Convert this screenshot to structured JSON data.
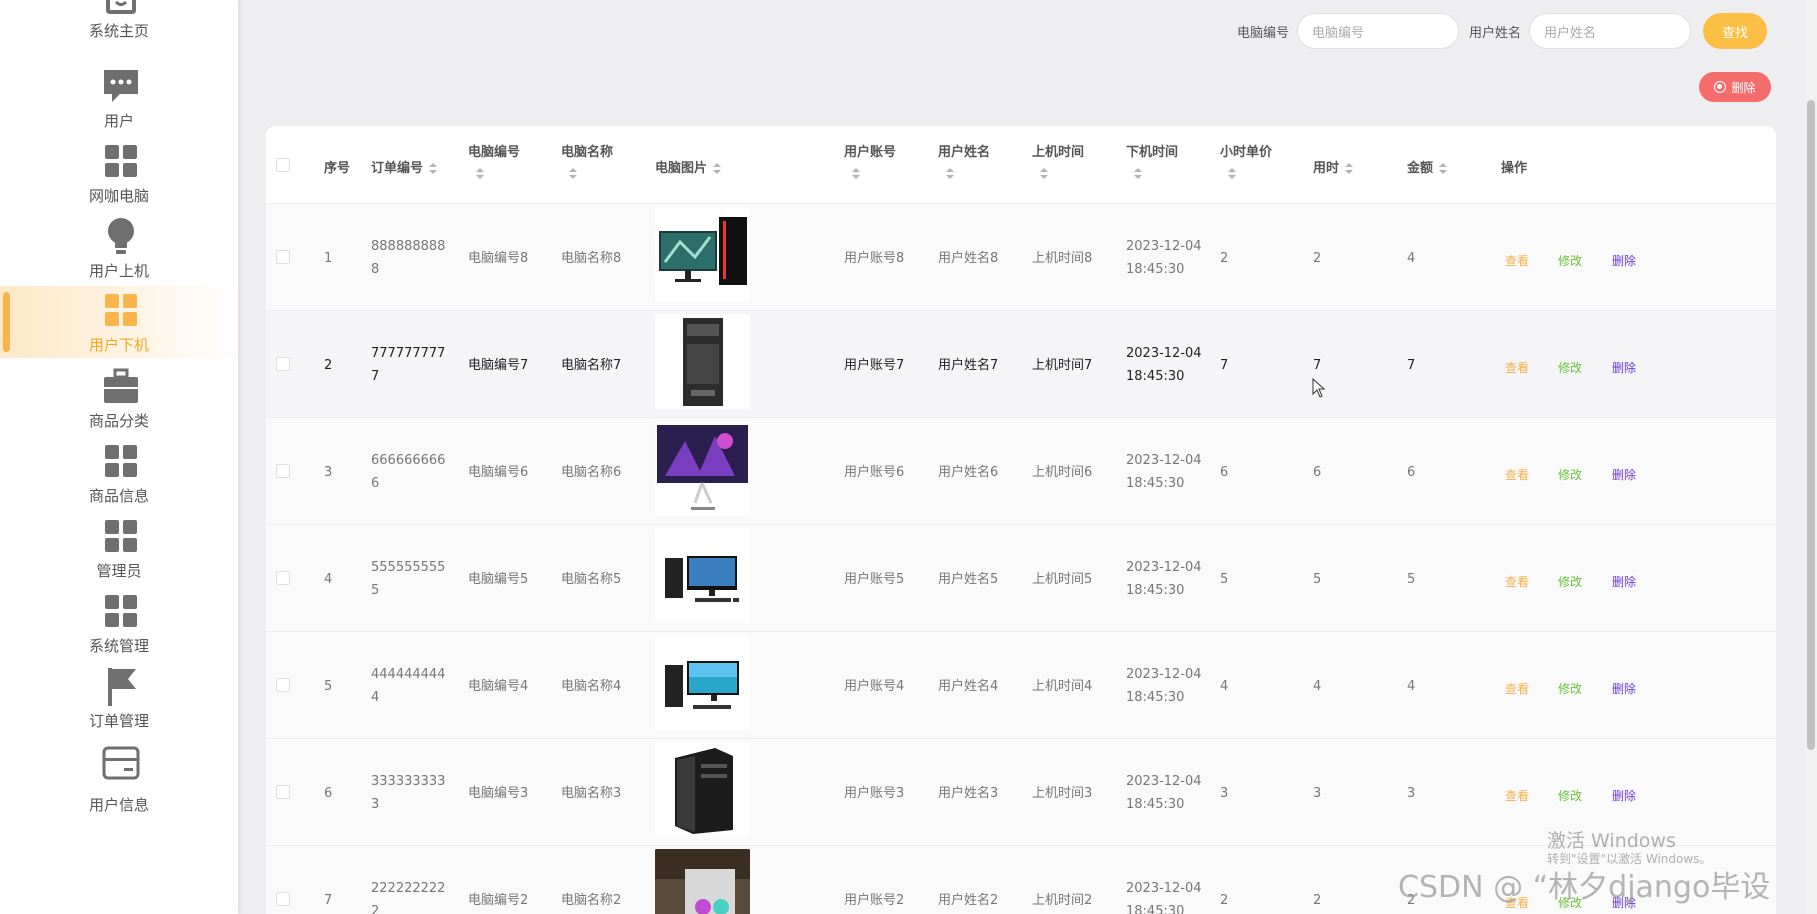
{
  "sidebar": {
    "items": [
      {
        "label": "系统主页",
        "icon": "home-box-icon"
      },
      {
        "label": "用户",
        "icon": "chat-icon"
      },
      {
        "label": "网咖电脑",
        "icon": "grid-icon"
      },
      {
        "label": "用户上机",
        "icon": "bulb-icon"
      },
      {
        "label": "用户下机",
        "icon": "grid-icon",
        "active": true
      },
      {
        "label": "商品分类",
        "icon": "briefcase-icon"
      },
      {
        "label": "商品信息",
        "icon": "grid-icon"
      },
      {
        "label": "管理员",
        "icon": "grid-icon"
      },
      {
        "label": "系统管理",
        "icon": "grid-icon"
      },
      {
        "label": "订单管理",
        "icon": "flag-icon"
      },
      {
        "label": "用户信息",
        "icon": "card-icon"
      }
    ]
  },
  "search": {
    "pc_number_label": "电脑编号",
    "pc_number_placeholder": "电脑编号",
    "user_name_label": "用户姓名",
    "user_name_placeholder": "用户姓名",
    "search_button": "查找",
    "delete_button": "删除"
  },
  "table": {
    "headers": {
      "index": "序号",
      "order_no": "订单编号",
      "pc_no": "电脑编号",
      "pc_name": "电脑名称",
      "pc_image": "电脑图片",
      "account": "用户账号",
      "user_name": "用户姓名",
      "start_time": "上机时间",
      "end_time": "下机时间",
      "hourly_price": "小时单价",
      "hours": "用时",
      "amount": "金额",
      "actions": "操作"
    },
    "action_labels": {
      "view": "查看",
      "edit": "修改",
      "delete": "删除"
    },
    "rows": [
      {
        "index": "1",
        "order_line1": "888888888",
        "order_line2": "8",
        "pc_no": "电脑编号8",
        "pc_name": "电脑名称8",
        "image": "gaming-pc-monitor",
        "account": "用户账号8",
        "user_name": "用户姓名8",
        "start_time": "上机时间8",
        "end_date": "2023-12-04",
        "end_clock": "18:45:30",
        "hourly_price": "2",
        "hours": "2",
        "amount": "4"
      },
      {
        "index": "2",
        "order_line1": "777777777",
        "order_line2": "7",
        "pc_no": "电脑编号7",
        "pc_name": "电脑名称7",
        "image": "tower-pc",
        "account": "用户账号7",
        "user_name": "用户姓名7",
        "start_time": "上机时间7",
        "end_date": "2023-12-04",
        "end_clock": "18:45:30",
        "hourly_price": "7",
        "hours": "7",
        "amount": "7"
      },
      {
        "index": "3",
        "order_line1": "666666666",
        "order_line2": "6",
        "pc_no": "电脑编号6",
        "pc_name": "电脑名称6",
        "image": "all-in-one-monitor",
        "account": "用户账号6",
        "user_name": "用户姓名6",
        "start_time": "上机时间6",
        "end_date": "2023-12-04",
        "end_clock": "18:45:30",
        "hourly_price": "6",
        "hours": "6",
        "amount": "6"
      },
      {
        "index": "4",
        "order_line1": "555555555",
        "order_line2": "5",
        "pc_no": "电脑编号5",
        "pc_name": "电脑名称5",
        "image": "desktop-set",
        "account": "用户账号5",
        "user_name": "用户姓名5",
        "start_time": "上机时间5",
        "end_date": "2023-12-04",
        "end_clock": "18:45:30",
        "hourly_price": "5",
        "hours": "5",
        "amount": "5"
      },
      {
        "index": "5",
        "order_line1": "444444444",
        "order_line2": "4",
        "pc_no": "电脑编号4",
        "pc_name": "电脑名称4",
        "image": "desktop-set-beach",
        "account": "用户账号4",
        "user_name": "用户姓名4",
        "start_time": "上机时间4",
        "end_date": "2023-12-04",
        "end_clock": "18:45:30",
        "hourly_price": "4",
        "hours": "4",
        "amount": "4"
      },
      {
        "index": "6",
        "order_line1": "333333333",
        "order_line2": "3",
        "pc_no": "电脑编号3",
        "pc_name": "电脑名称3",
        "image": "black-tower",
        "account": "用户账号3",
        "user_name": "用户姓名3",
        "start_time": "上机时间3",
        "end_date": "2023-12-04",
        "end_clock": "18:45:30",
        "hourly_price": "3",
        "hours": "3",
        "amount": "3"
      },
      {
        "index": "7",
        "order_line1": "222222222",
        "order_line2": "2",
        "pc_no": "电脑编号2",
        "pc_name": "电脑名称2",
        "image": "rgb-tower",
        "account": "用户账号2",
        "user_name": "用户姓名2",
        "start_time": "上机时间2",
        "end_date": "2023-12-04",
        "end_clock": "18:45:30",
        "hourly_price": "2",
        "hours": "2",
        "amount": "2"
      }
    ]
  },
  "overlay": {
    "activate_title": "激活 Windows",
    "activate_sub": "转到\"设置\"以激活 Windows。",
    "csdn": "CSDN @ “林夕django毕设"
  },
  "colors": {
    "accent": "#f7b54b",
    "search_button": "#fbbf45",
    "delete_button": "#f56c6c",
    "view_link": "#f5b04a",
    "edit_link": "#67c23a",
    "delete_link": "#6a3bd8"
  }
}
